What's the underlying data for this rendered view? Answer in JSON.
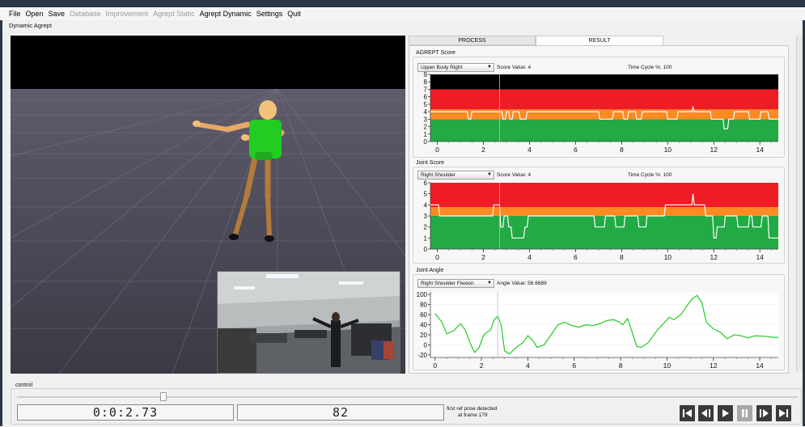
{
  "menu": [
    {
      "label": "File",
      "enabled": true
    },
    {
      "label": "Open",
      "enabled": true
    },
    {
      "label": "Save",
      "enabled": true
    },
    {
      "label": "Database",
      "enabled": false
    },
    {
      "label": "Improvement",
      "enabled": false
    },
    {
      "label": "Agrept Static",
      "enabled": false
    },
    {
      "label": "Agrept Dynamic",
      "enabled": true
    },
    {
      "label": "Settings",
      "enabled": true
    },
    {
      "label": "Quit",
      "enabled": true
    }
  ],
  "subtitle": "Dynamic Agrept",
  "tabs": {
    "process": "PROCESS",
    "result": "RESULT",
    "active": "RESULT"
  },
  "agrept_score": {
    "section": "AGREPT Score",
    "selector": "Upper Body Right",
    "score_text": "Score Value: 4",
    "cycle_text": "Time Cycle %: 100"
  },
  "joint_score": {
    "section": "Joint Score",
    "selector": "Right Shoulder",
    "score_text": "Score Value: 4",
    "cycle_text": "Time Cycle %: 100"
  },
  "joint_angle": {
    "section": "Joint Angle",
    "selector": "Right Shoulder Flexion",
    "angle_text": "Angle Value: 56.6689"
  },
  "chart_data": [
    {
      "type": "line",
      "section": "AGREPT Score",
      "x_ticks": [
        0,
        2,
        4,
        6,
        8,
        10,
        12,
        14
      ],
      "y_ticks": [
        0,
        1,
        2,
        3,
        4,
        5,
        6,
        7,
        8,
        9
      ],
      "xlim": [
        -0.3,
        14.8
      ],
      "ylim": [
        0,
        9
      ],
      "bands": [
        {
          "from": 0,
          "to": 3,
          "color": "#22aa44"
        },
        {
          "from": 3,
          "to": 4.3,
          "color": "#ff8a22"
        },
        {
          "from": 4.3,
          "to": 7,
          "color": "#ee1c24"
        },
        {
          "from": 7,
          "to": 9,
          "color": "#000000"
        }
      ],
      "series": [
        {
          "color": "#ffffff",
          "points": [
            [
              -0.3,
              4
            ],
            [
              1.3,
              4
            ],
            [
              1.35,
              3
            ],
            [
              1.45,
              3
            ],
            [
              1.5,
              4
            ],
            [
              2.8,
              4
            ],
            [
              2.85,
              3
            ],
            [
              2.95,
              3
            ],
            [
              3.0,
              4
            ],
            [
              3.1,
              4
            ],
            [
              3.15,
              3
            ],
            [
              3.25,
              3
            ],
            [
              3.3,
              4
            ],
            [
              3.55,
              4
            ],
            [
              3.6,
              3
            ],
            [
              3.85,
              3
            ],
            [
              3.9,
              4
            ],
            [
              7.0,
              4
            ],
            [
              7.05,
              3
            ],
            [
              7.6,
              3
            ],
            [
              7.65,
              4
            ],
            [
              8.05,
              4
            ],
            [
              8.1,
              3
            ],
            [
              8.25,
              3
            ],
            [
              8.3,
              4
            ],
            [
              8.6,
              4
            ],
            [
              8.65,
              3
            ],
            [
              8.85,
              3
            ],
            [
              8.9,
              4
            ],
            [
              9.95,
              4
            ],
            [
              10.0,
              3
            ],
            [
              10.4,
              3
            ],
            [
              10.45,
              4
            ],
            [
              11.05,
              4
            ],
            [
              11.1,
              4.6
            ],
            [
              11.15,
              4
            ],
            [
              11.85,
              4
            ],
            [
              11.9,
              3
            ],
            [
              12.4,
              3
            ],
            [
              12.45,
              1.7
            ],
            [
              12.6,
              1.7
            ],
            [
              12.65,
              3
            ],
            [
              12.85,
              3
            ],
            [
              12.9,
              4
            ],
            [
              13.5,
              4
            ],
            [
              13.55,
              3
            ],
            [
              14.0,
              3
            ],
            [
              14.05,
              4
            ],
            [
              14.35,
              4
            ],
            [
              14.4,
              3
            ],
            [
              14.8,
              3
            ]
          ]
        }
      ],
      "cursor_x": 2.7
    },
    {
      "type": "line",
      "section": "Joint Score",
      "x_ticks": [
        0,
        2,
        4,
        6,
        8,
        10,
        12,
        14
      ],
      "y_ticks": [
        0,
        1,
        2,
        3,
        4,
        5,
        6
      ],
      "xlim": [
        -0.3,
        14.8
      ],
      "ylim": [
        0,
        6
      ],
      "bands": [
        {
          "from": 0,
          "to": 3,
          "color": "#22aa44"
        },
        {
          "from": 3,
          "to": 3.8,
          "color": "#ff8a22"
        },
        {
          "from": 3.8,
          "to": 6,
          "color": "#ee1c24"
        }
      ],
      "series": [
        {
          "color": "#ffffff",
          "points": [
            [
              -0.3,
              4
            ],
            [
              0.05,
              4
            ],
            [
              0.1,
              3
            ],
            [
              2.4,
              3
            ],
            [
              2.45,
              4
            ],
            [
              2.7,
              4
            ],
            [
              2.75,
              2
            ],
            [
              2.85,
              2
            ],
            [
              2.9,
              3
            ],
            [
              3.05,
              3
            ],
            [
              3.1,
              2
            ],
            [
              3.2,
              2
            ],
            [
              3.25,
              1
            ],
            [
              3.75,
              1
            ],
            [
              3.8,
              2
            ],
            [
              3.9,
              2
            ],
            [
              3.95,
              3
            ],
            [
              6.8,
              3
            ],
            [
              6.85,
              2
            ],
            [
              7.25,
              2
            ],
            [
              7.3,
              3
            ],
            [
              7.7,
              3
            ],
            [
              7.75,
              2
            ],
            [
              8.1,
              2
            ],
            [
              8.15,
              3
            ],
            [
              8.7,
              3
            ],
            [
              8.75,
              2
            ],
            [
              9.05,
              2
            ],
            [
              9.1,
              3
            ],
            [
              9.85,
              3
            ],
            [
              9.9,
              4
            ],
            [
              11.05,
              4
            ],
            [
              11.1,
              5
            ],
            [
              11.15,
              4
            ],
            [
              11.6,
              4
            ],
            [
              11.65,
              3
            ],
            [
              11.95,
              3
            ],
            [
              12.0,
              1
            ],
            [
              12.1,
              1
            ],
            [
              12.15,
              2
            ],
            [
              12.45,
              2
            ],
            [
              12.5,
              3
            ],
            [
              13.0,
              3
            ],
            [
              13.05,
              2
            ],
            [
              13.5,
              2
            ],
            [
              13.55,
              3
            ],
            [
              13.65,
              3
            ],
            [
              13.7,
              2
            ],
            [
              14.05,
              2
            ],
            [
              14.1,
              3
            ],
            [
              14.35,
              3
            ],
            [
              14.4,
              1
            ],
            [
              14.8,
              1
            ]
          ]
        }
      ],
      "cursor_x": 2.7
    },
    {
      "type": "line",
      "section": "Joint Angle",
      "x_ticks": [
        0,
        2,
        4,
        6,
        8,
        10,
        12,
        14
      ],
      "y_ticks": [
        -20,
        0,
        20,
        40,
        60,
        80,
        100
      ],
      "xlim": [
        -0.2,
        14.8
      ],
      "ylim": [
        -25,
        105
      ],
      "bands": [],
      "series": [
        {
          "color": "#22cc22",
          "points": [
            [
              0,
              62
            ],
            [
              0.3,
              45
            ],
            [
              0.5,
              22
            ],
            [
              0.8,
              28
            ],
            [
              1.1,
              42
            ],
            [
              1.3,
              30
            ],
            [
              1.5,
              5
            ],
            [
              1.7,
              -15
            ],
            [
              1.9,
              -5
            ],
            [
              2.1,
              20
            ],
            [
              2.4,
              30
            ],
            [
              2.55,
              50
            ],
            [
              2.7,
              57
            ],
            [
              2.85,
              40
            ],
            [
              3.0,
              -12
            ],
            [
              3.2,
              -18
            ],
            [
              3.5,
              -5
            ],
            [
              3.8,
              5
            ],
            [
              4.0,
              18
            ],
            [
              4.2,
              10
            ],
            [
              4.4,
              -5
            ],
            [
              4.7,
              0
            ],
            [
              5.0,
              20
            ],
            [
              5.3,
              40
            ],
            [
              5.6,
              45
            ],
            [
              5.9,
              38
            ],
            [
              6.2,
              35
            ],
            [
              6.5,
              40
            ],
            [
              6.8,
              38
            ],
            [
              7.1,
              42
            ],
            [
              7.4,
              48
            ],
            [
              7.7,
              50
            ],
            [
              7.95,
              45
            ],
            [
              8.1,
              40
            ],
            [
              8.3,
              52
            ],
            [
              8.5,
              25
            ],
            [
              8.7,
              -3
            ],
            [
              8.9,
              -5
            ],
            [
              9.2,
              5
            ],
            [
              9.6,
              30
            ],
            [
              9.9,
              45
            ],
            [
              10.1,
              55
            ],
            [
              10.3,
              50
            ],
            [
              10.6,
              60
            ],
            [
              10.9,
              80
            ],
            [
              11.1,
              92
            ],
            [
              11.3,
              98
            ],
            [
              11.5,
              85
            ],
            [
              11.7,
              45
            ],
            [
              12.0,
              32
            ],
            [
              12.3,
              25
            ],
            [
              12.6,
              12
            ],
            [
              12.9,
              20
            ],
            [
              13.2,
              18
            ],
            [
              13.5,
              14
            ],
            [
              13.8,
              18
            ],
            [
              14.2,
              17
            ],
            [
              14.6,
              15
            ],
            [
              14.8,
              15
            ]
          ]
        }
      ],
      "cursor_x": 2.7
    }
  ],
  "control": {
    "label": "control",
    "time_display": "0:0:2.73",
    "frame_display": "82",
    "status_line1": "first ref pose detected",
    "status_line2": "at frame 179",
    "slider_value": 0.19
  },
  "player_buttons": [
    {
      "name": "skip-to-start-icon",
      "glyph": "⏮",
      "enabled": true
    },
    {
      "name": "step-back-icon",
      "glyph": "⏴",
      "enabled": true
    },
    {
      "name": "play-icon",
      "glyph": "▶",
      "enabled": true
    },
    {
      "name": "pause-icon",
      "glyph": "⏸",
      "enabled": false
    },
    {
      "name": "step-forward-icon",
      "glyph": "⏵",
      "enabled": true
    },
    {
      "name": "skip-to-end-icon",
      "glyph": "⏭",
      "enabled": true
    }
  ]
}
